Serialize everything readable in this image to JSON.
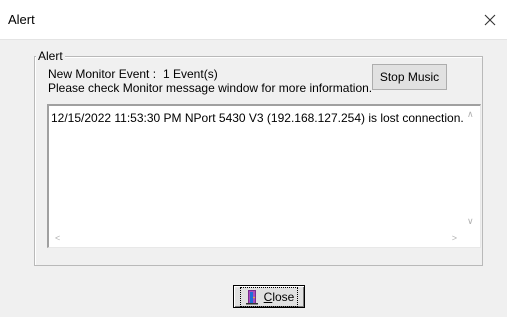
{
  "window": {
    "title": "Alert"
  },
  "group": {
    "label": "Alert",
    "event_label": "New Monitor Event :",
    "event_count": "1 Event(s)",
    "hint": "Please check Monitor message window for more information.",
    "stop_label": "Stop Music"
  },
  "messages": [
    "12/15/2022 11:53:30 PM NPort 5430 V3 (192.168.127.254) is lost connection."
  ],
  "footer": {
    "close_label": "Close",
    "close_mnemonic": "C",
    "close_rest": "lose"
  },
  "icons": {
    "close": "x-icon",
    "door": "door-icon"
  }
}
